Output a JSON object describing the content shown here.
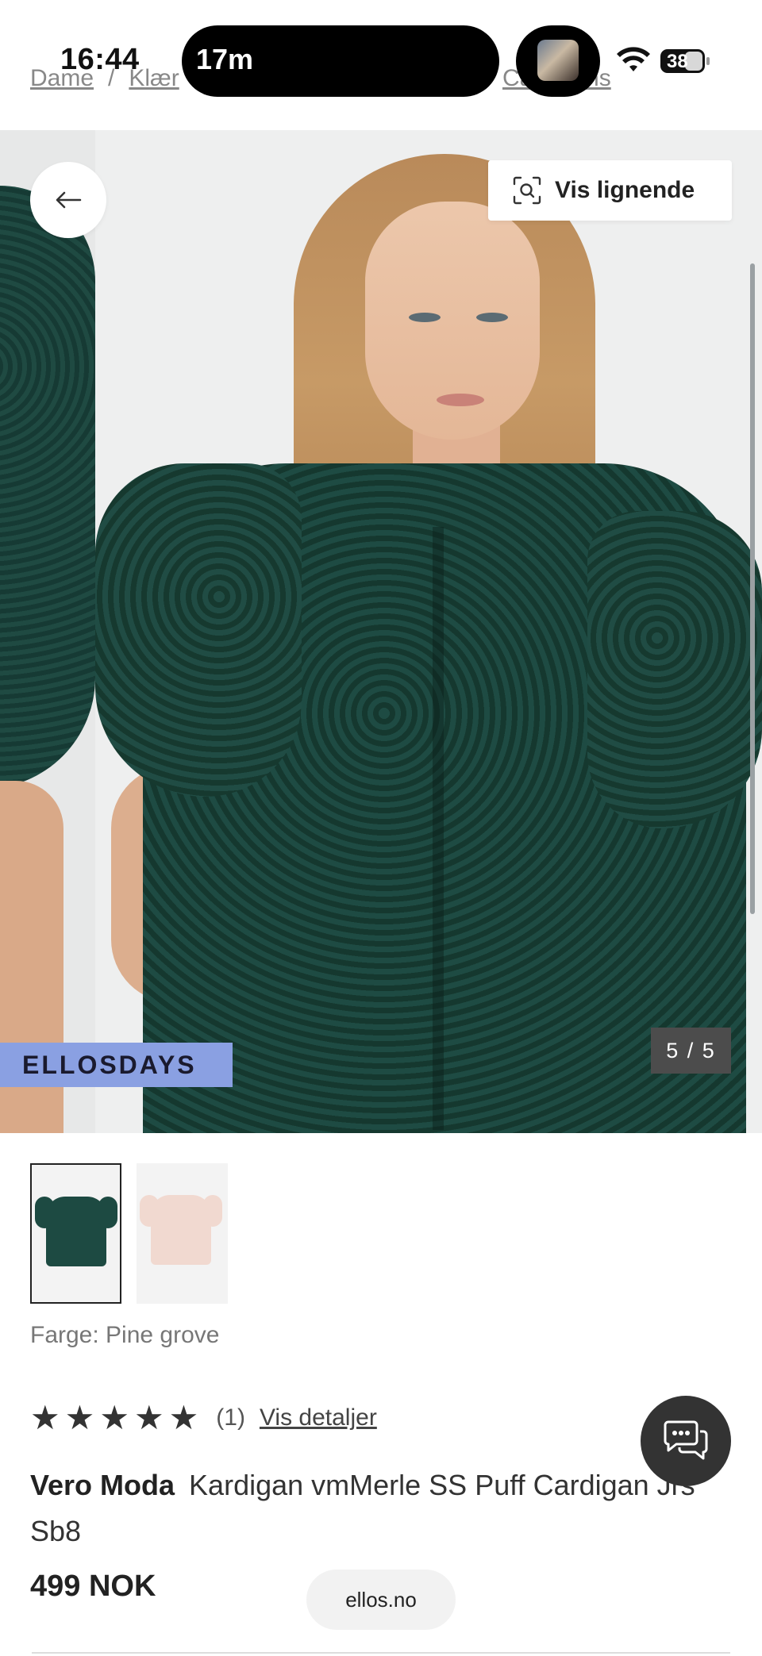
{
  "status_bar": {
    "time": "16:44",
    "activity_text": "17m",
    "battery": "38"
  },
  "breadcrumb": {
    "items": [
      "Dame",
      "/",
      "Klær"
    ],
    "last": "Cardigans"
  },
  "gallery": {
    "similar_label": "Vis lignende",
    "promo_badge": "ELLOSDAYS",
    "counter": "5 / 5"
  },
  "swatches": [
    {
      "name": "Pine grove",
      "color": "#1d4a42"
    },
    {
      "name": "Pink",
      "color": "#f1d9d0"
    }
  ],
  "product": {
    "color_label": "Farge: Pine grove",
    "rating_stars": "★★★★★",
    "rating_value": 5,
    "rating_count": "(1)",
    "details_link": "Vis detaljer",
    "brand": "Vero Moda",
    "name": "Kardigan vmMerle SS Puff Cardigan Jrs Sb8",
    "price": "499 NOK"
  },
  "browser": {
    "url": "ellos.no"
  },
  "icons": {
    "back": "arrow-left-icon",
    "similar": "visual-search-icon",
    "chat": "chat-bubbles-icon",
    "wifi": "wifi-icon"
  }
}
